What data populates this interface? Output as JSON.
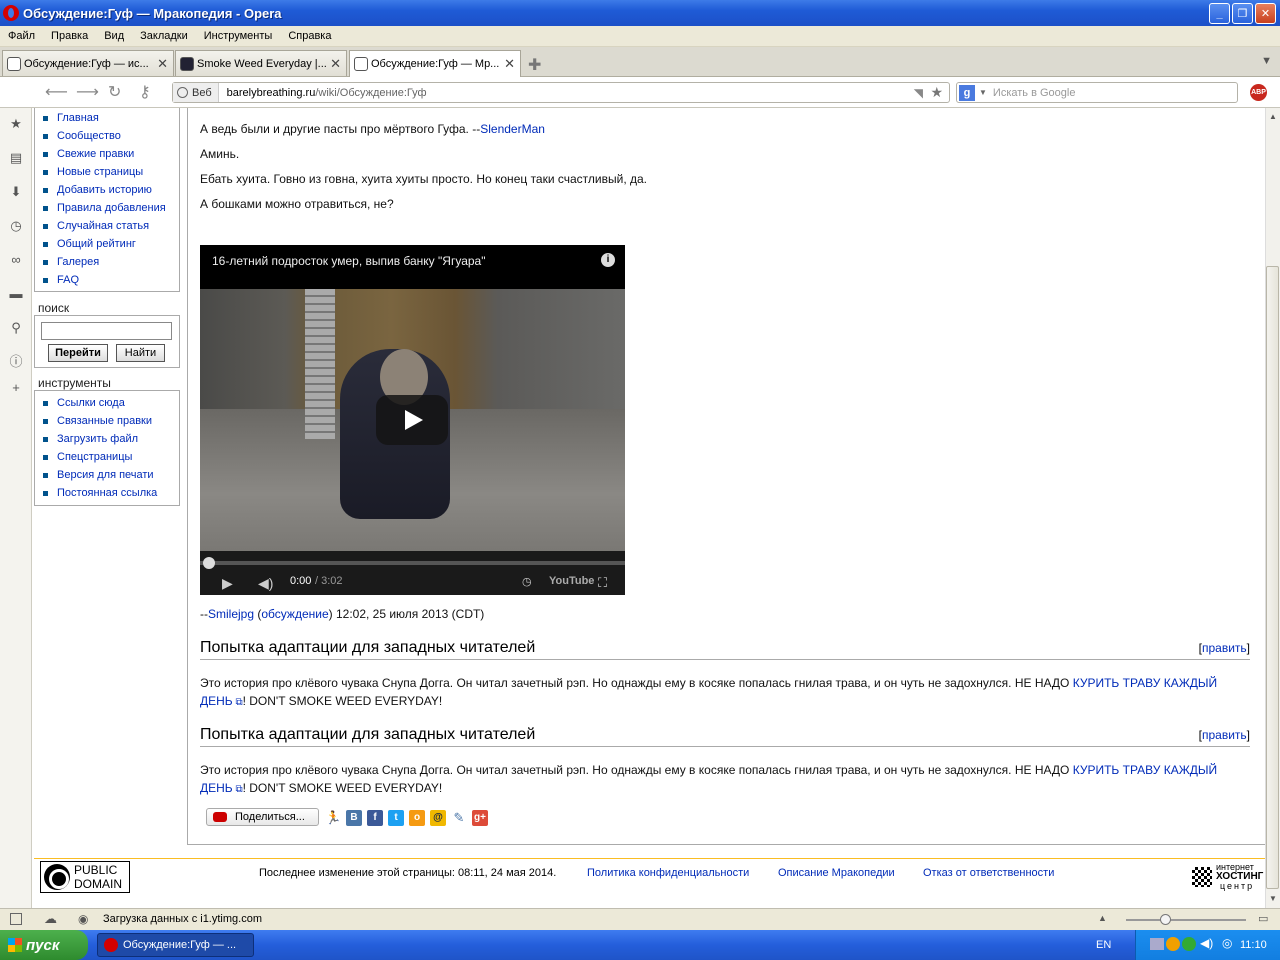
{
  "window": {
    "title": "Обсуждение:Гуф — Мракопедия - Opera"
  },
  "menu": [
    "Файл",
    "Правка",
    "Вид",
    "Закладки",
    "Инструменты",
    "Справка"
  ],
  "tabs": [
    {
      "label": "Обсуждение:Гуф — ис..."
    },
    {
      "label": "Smoke Weed Everyday |..."
    },
    {
      "label": "Обсуждение:Гуф — Мр..."
    }
  ],
  "address": {
    "mode": "Веб",
    "domain": "barelybreathing.ru",
    "path": "/wiki/Обсуждение:Гуф",
    "search_placeholder": "Искать в Google"
  },
  "sidebar": {
    "nav": [
      "Главная",
      "Сообщество",
      "Свежие правки",
      "Новые страницы",
      "Добавить историю",
      "Правила добавления",
      "Случайная статья",
      "Общий рейтинг",
      "Галерея",
      "FAQ"
    ],
    "search_title": "поиск",
    "search_go": "Перейти",
    "search_find": "Найти",
    "tools_title": "инструменты",
    "tools": [
      "Ссылки сюда",
      "Связанные правки",
      "Загрузить файл",
      "Спецстраницы",
      "Версия для печати",
      "Постоянная ссылка"
    ]
  },
  "content": {
    "line1_text": "А ведь были и другие пасты про мёртвого Гуфа. --",
    "line1_link": "SlenderMan",
    "line2": "Аминь.",
    "line3": "Ебать хуита. Говно из говна, хуита хуиты просто. Но конец таки счастливый, да.",
    "line4": "А бошками можно отравиться, не?",
    "video": {
      "title": "16-летний подросток умер, выпив банку \"Ягуара\"",
      "time_current": "0:00",
      "time_total": "/ 3:02",
      "brand": "YouTube",
      "progress": 0
    },
    "sig": {
      "prefix": "--",
      "user": "Smilejpg",
      "talk": "обсуждение",
      "date": ") 12:02, 25 июля 2013 (CDT)"
    },
    "sections": [
      {
        "heading": "Попытка адаптации для западных читателей",
        "edit": "править",
        "text": "Это история про клёвого чувака Снупа Догга. Он читал зачетный рэп. Но однажды ему в косяке попалась гнилая трава, и он чуть не задохнулся. НЕ НАДО ",
        "link": "КУРИТЬ ТРАВУ КАЖДЫЙ ДЕНЬ",
        "tail": "! DON'T SMOKE WEED EVERYDAY!"
      },
      {
        "heading": "Попытка адаптации для западных читателей",
        "edit": "править",
        "text": "Это история про клёвого чувака Снупа Догга. Он читал зачетный рэп. Но однажды ему в косяке попалась гнилая трава, и он чуть не задохнулся. НЕ НАДО ",
        "link": "КУРИТЬ ТРАВУ КАЖДЫЙ ДЕНЬ",
        "tail": "! DON'T SMOKE WEED EVERYDAY!"
      }
    ],
    "share_label": "Поделиться..."
  },
  "footer": {
    "pd_line1": "PUBLIC",
    "pd_line2": "DOMAIN",
    "last_modified": "Последнее изменение этой страницы: 08:11, 24 мая 2014.",
    "privacy": "Политика конфиденциальности",
    "about": "Описание Мракопедии",
    "disclaimer": "Отказ от ответственности",
    "host1": "интернет",
    "host2": "ХОСТИНГ",
    "host3": "центр"
  },
  "status": {
    "loading": "Загрузка данных с i1.ytimg.com"
  },
  "taskbar": {
    "start": "пуск",
    "task": "Обсуждение:Гуф — ...",
    "lang": "EN",
    "clock": "11:10"
  }
}
